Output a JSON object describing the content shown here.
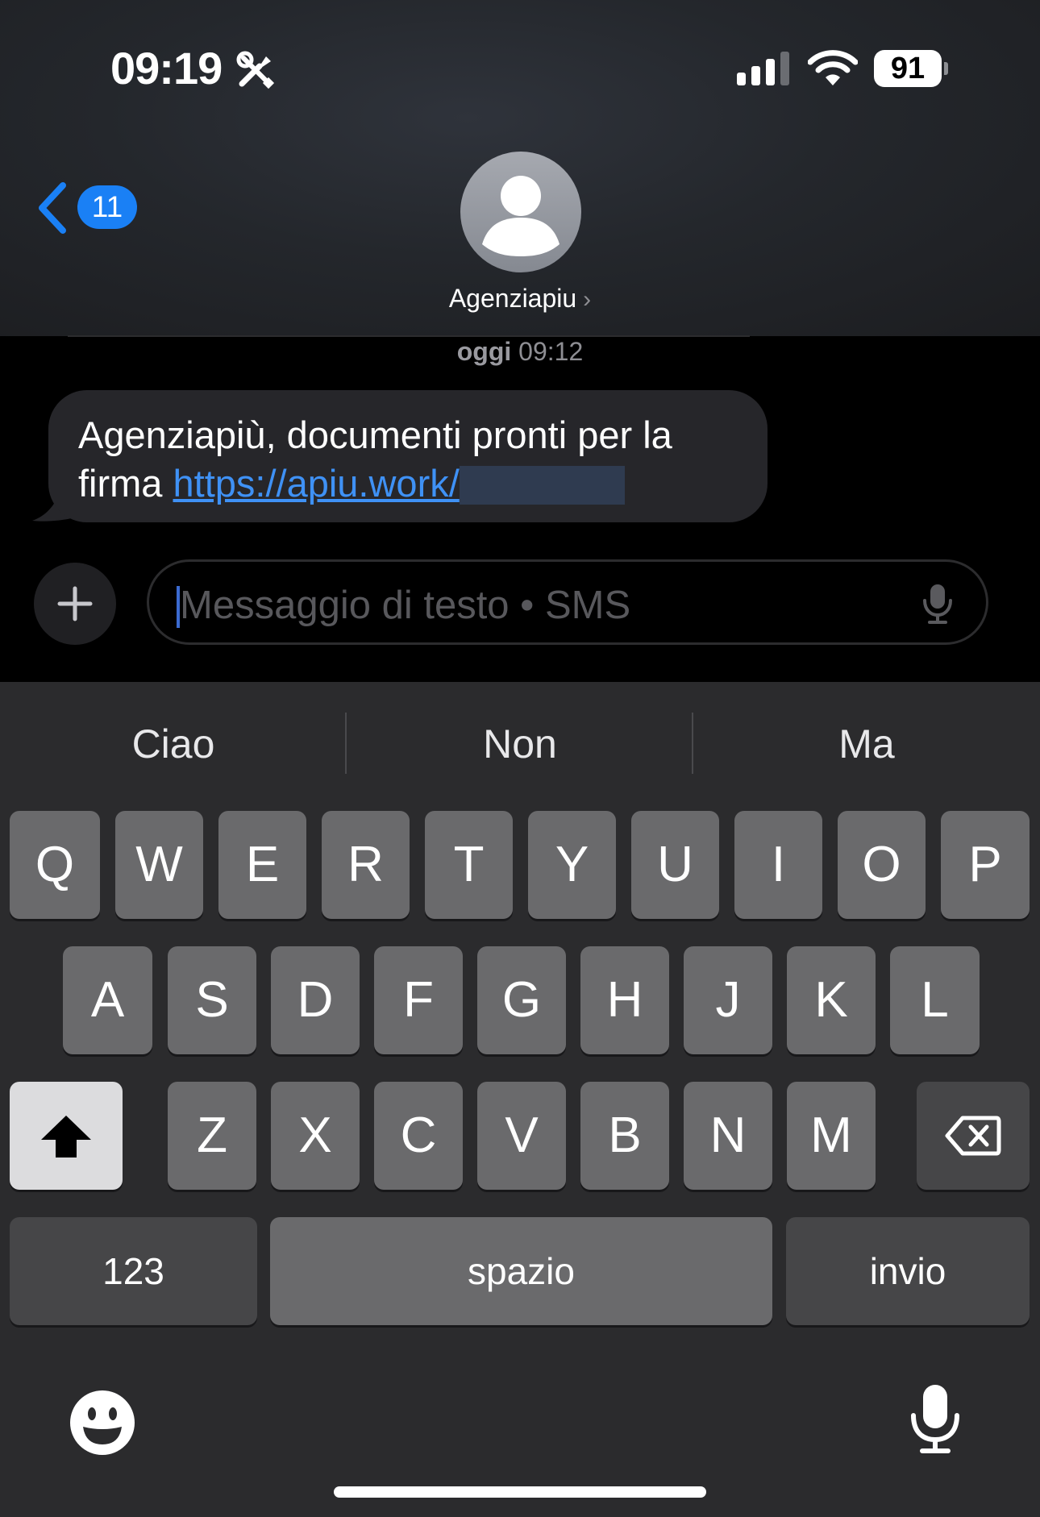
{
  "status_bar": {
    "time": "09:19",
    "battery": "91",
    "icons": [
      "tools-icon",
      "signal-icon",
      "wifi-icon",
      "battery-icon"
    ]
  },
  "nav": {
    "back_badge": "11",
    "contact_name": "Agenziapiu",
    "contact_chevron": "›"
  },
  "thread": {
    "timestamp_day": "oggi",
    "timestamp_time": "09:12",
    "message": {
      "text_before_link": "Agenziapiù, documenti pronti per la firma ",
      "link": "https://apiu.work/"
    }
  },
  "composer": {
    "placeholder": "Messaggio di testo • SMS",
    "plus_label": "+"
  },
  "keyboard": {
    "suggestions": [
      "Ciao",
      "Non",
      "Ma"
    ],
    "row1": [
      "Q",
      "W",
      "E",
      "R",
      "T",
      "Y",
      "U",
      "I",
      "O",
      "P"
    ],
    "row2": [
      "A",
      "S",
      "D",
      "F",
      "G",
      "H",
      "J",
      "K",
      "L"
    ],
    "row3": [
      "Z",
      "X",
      "C",
      "V",
      "B",
      "N",
      "M"
    ],
    "numbers_label": "123",
    "space_label": "spazio",
    "return_label": "invio"
  },
  "colors": {
    "accent": "#1a80f5",
    "link": "#3f91f5",
    "bubble": "#26262a",
    "keyboard_bg": "#2b2b2d",
    "key": "#6a6a6c"
  }
}
